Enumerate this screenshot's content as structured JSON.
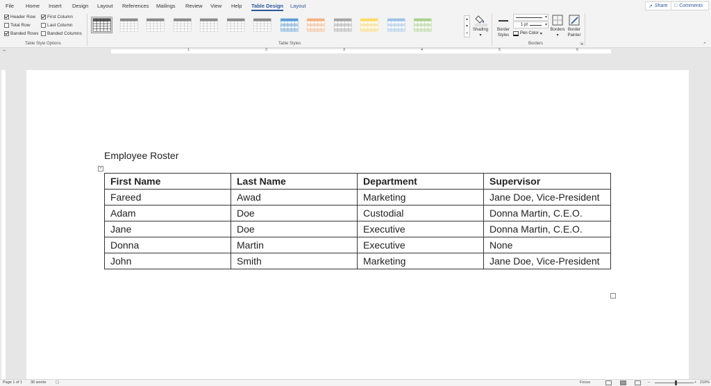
{
  "menu": {
    "items": [
      "File",
      "Home",
      "Insert",
      "Design",
      "Layout",
      "References",
      "Mailings",
      "Review",
      "View",
      "Help",
      "Table Design",
      "Layout"
    ],
    "active": "Table Design",
    "share": "Share",
    "comments": "Comments"
  },
  "ribbon": {
    "options": [
      {
        "label": "Header Row",
        "checked": true
      },
      {
        "label": "Total Row",
        "checked": false
      },
      {
        "label": "Banded Rows",
        "checked": true
      },
      {
        "label": "First Column",
        "checked": true
      },
      {
        "label": "Last Column",
        "checked": false
      },
      {
        "label": "Banded Columns",
        "checked": false
      }
    ],
    "group_options_label": "Table Style Options",
    "group_styles_label": "Table Styles",
    "group_borders_label": "Borders",
    "shading": "Shading",
    "border_styles": [
      "Border",
      "Styles"
    ],
    "pen_weight": "1 pt",
    "pen_color": "Pen Color",
    "borders": "Borders",
    "border_painter": [
      "Border",
      "Painter"
    ],
    "swatch_colors": [
      "#555555",
      "#888888",
      "#888888",
      "#888888",
      "#888888",
      "#888888",
      "#888888",
      "#5b9bd5",
      "#f4b183",
      "#a5a5a5",
      "#ffd966",
      "#9dc3e6",
      "#a9d18e"
    ]
  },
  "ruler": {
    "numbers": [
      "1",
      "2",
      "3",
      "4",
      "5",
      "6"
    ]
  },
  "document": {
    "title": "Employee Roster",
    "table": {
      "headers": [
        "First Name",
        "Last Name",
        "Department",
        "Supervisor"
      ],
      "rows": [
        [
          "Fareed",
          "Awad",
          "Marketing",
          "Jane Doe, Vice-President"
        ],
        [
          "Adam",
          "Doe",
          "Custodial",
          "Donna Martin, C.E.O."
        ],
        [
          "Jane",
          "Doe",
          "Executive",
          "Donna Martin, C.E.O."
        ],
        [
          "Donna",
          "Martin",
          "Executive",
          "None"
        ],
        [
          "John",
          "Smith",
          "Marketing",
          "Jane Doe, Vice-President"
        ]
      ]
    }
  },
  "status": {
    "page": "Page 1 of 1",
    "words": "36 words",
    "focus": "Focus",
    "zoom": "210%"
  }
}
